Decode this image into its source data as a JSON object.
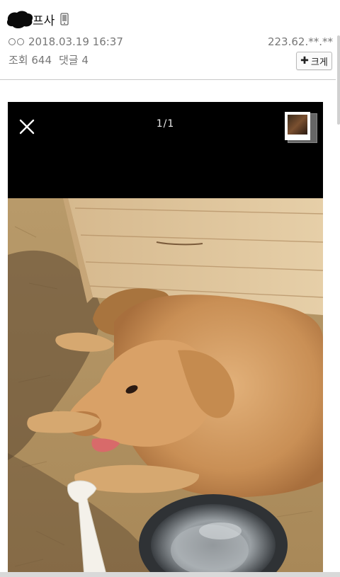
{
  "post": {
    "author": "프사",
    "ip": "223.62.**.**",
    "date": "2018.03.19 16:37",
    "views_label": "조회 644",
    "comments_label": "댓글 4"
  },
  "zoom_button": {
    "label": "크게"
  },
  "viewer": {
    "counter": "1/1"
  },
  "icons": {
    "author_blot": "scribble-blot-icon",
    "device": "mobile-device-icon",
    "close": "close-icon",
    "plus": "plus-icon",
    "thumbnail": "photo-thumbnail-icon"
  },
  "colors": {
    "meta_text": "#777777",
    "viewer_bg": "#000000"
  }
}
